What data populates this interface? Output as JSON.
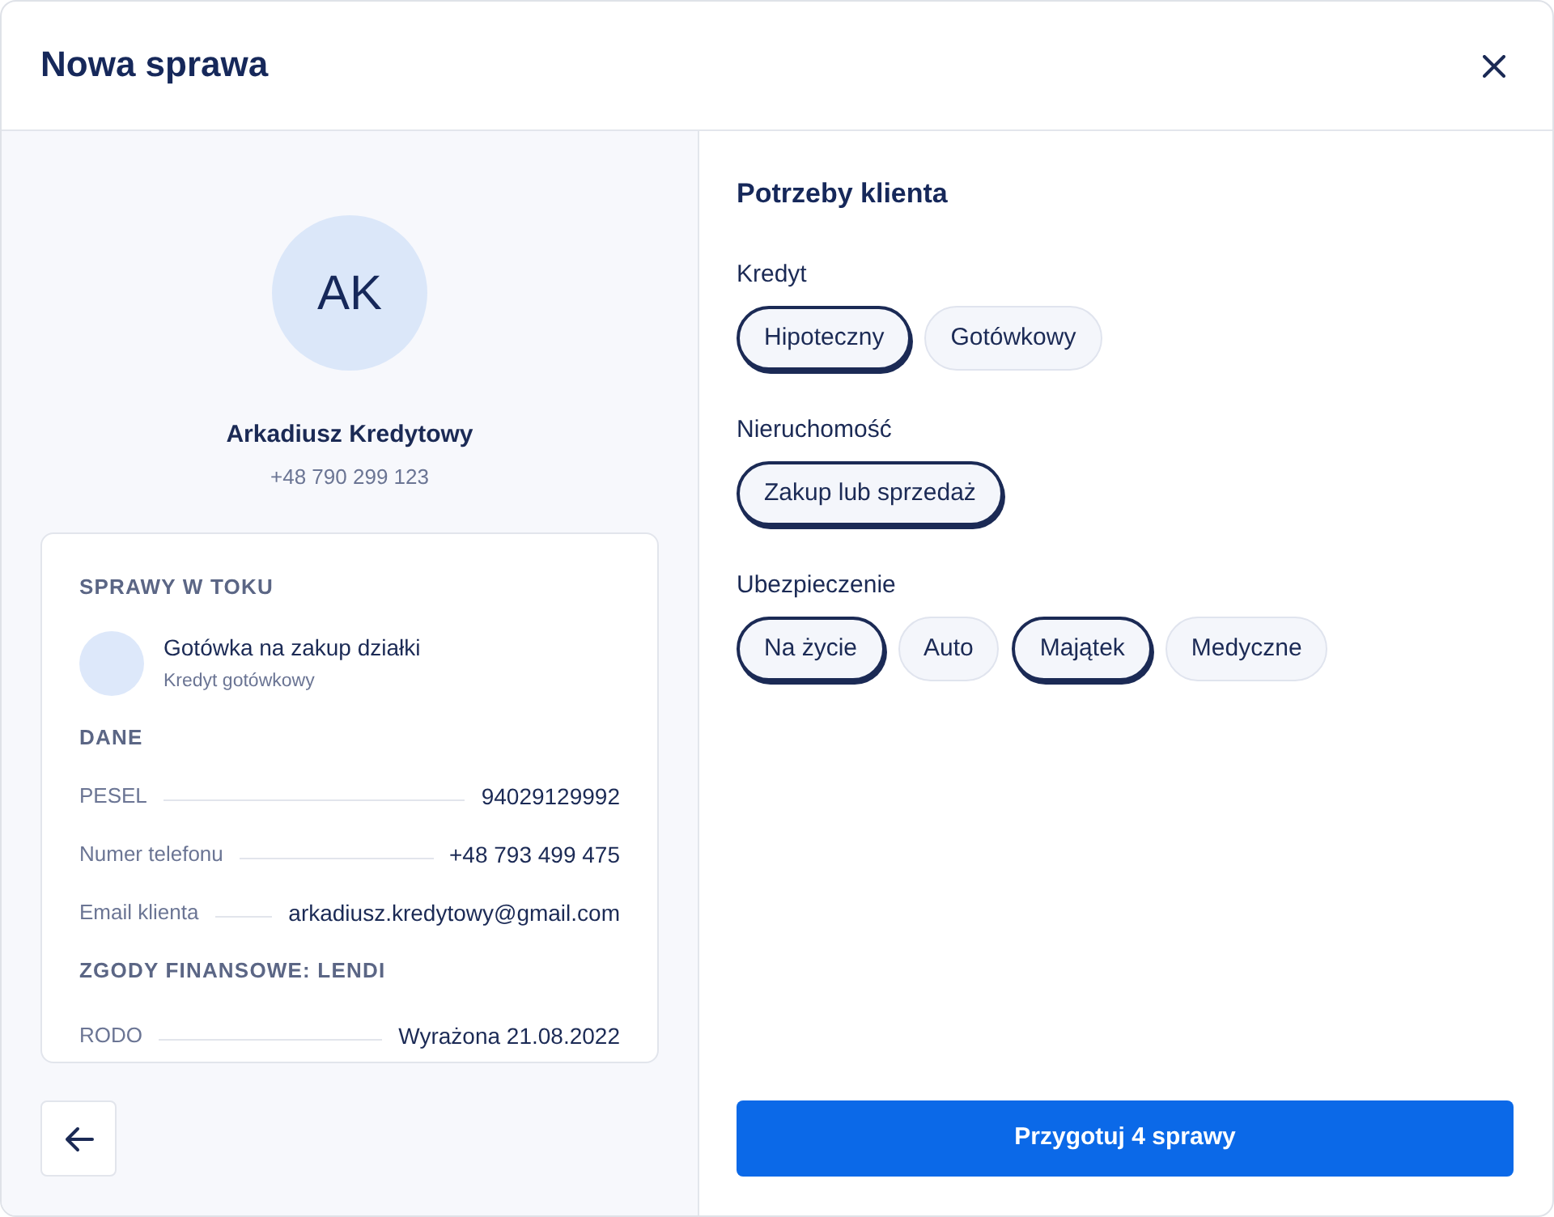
{
  "dialog": {
    "title": "Nowa sprawa"
  },
  "client": {
    "initials": "AK",
    "name": "Arkadiusz Kredytowy",
    "phone": "+48 790 299 123"
  },
  "details_card": {
    "sections": [
      {
        "kind": "cases",
        "heading": "SPRAWY W TOKU",
        "items": [
          {
            "title": "Gotówka na zakup działki",
            "subtitle": "Kredyt gotówkowy"
          }
        ]
      },
      {
        "kind": "fields",
        "heading": "DANE",
        "rows": [
          {
            "label": "PESEL",
            "value": "94029129992"
          },
          {
            "label": "Numer telefonu",
            "value": "+48 793 499 475"
          },
          {
            "label": "Email klienta",
            "value": "arkadiusz.kredytowy@gmail.com"
          }
        ]
      },
      {
        "kind": "fields",
        "heading": "ZGODY FINANSOWE: LENDI",
        "rows": [
          {
            "label": "RODO",
            "value": "Wyrażona 21.08.2022"
          }
        ]
      }
    ]
  },
  "needs": {
    "title": "Potrzeby klienta",
    "groups": [
      {
        "label": "Kredyt",
        "options": [
          {
            "label": "Hipoteczny",
            "selected": true
          },
          {
            "label": "Gotówkowy",
            "selected": false
          }
        ]
      },
      {
        "label": "Nieruchomość",
        "options": [
          {
            "label": "Zakup lub sprzedaż",
            "selected": true
          }
        ]
      },
      {
        "label": "Ubezpieczenie",
        "options": [
          {
            "label": "Na życie",
            "selected": true
          },
          {
            "label": "Auto",
            "selected": false
          },
          {
            "label": "Majątek",
            "selected": true
          },
          {
            "label": "Medyczne",
            "selected": false
          }
        ]
      }
    ]
  },
  "submit_button": "Przygotuj 4 sprawy"
}
